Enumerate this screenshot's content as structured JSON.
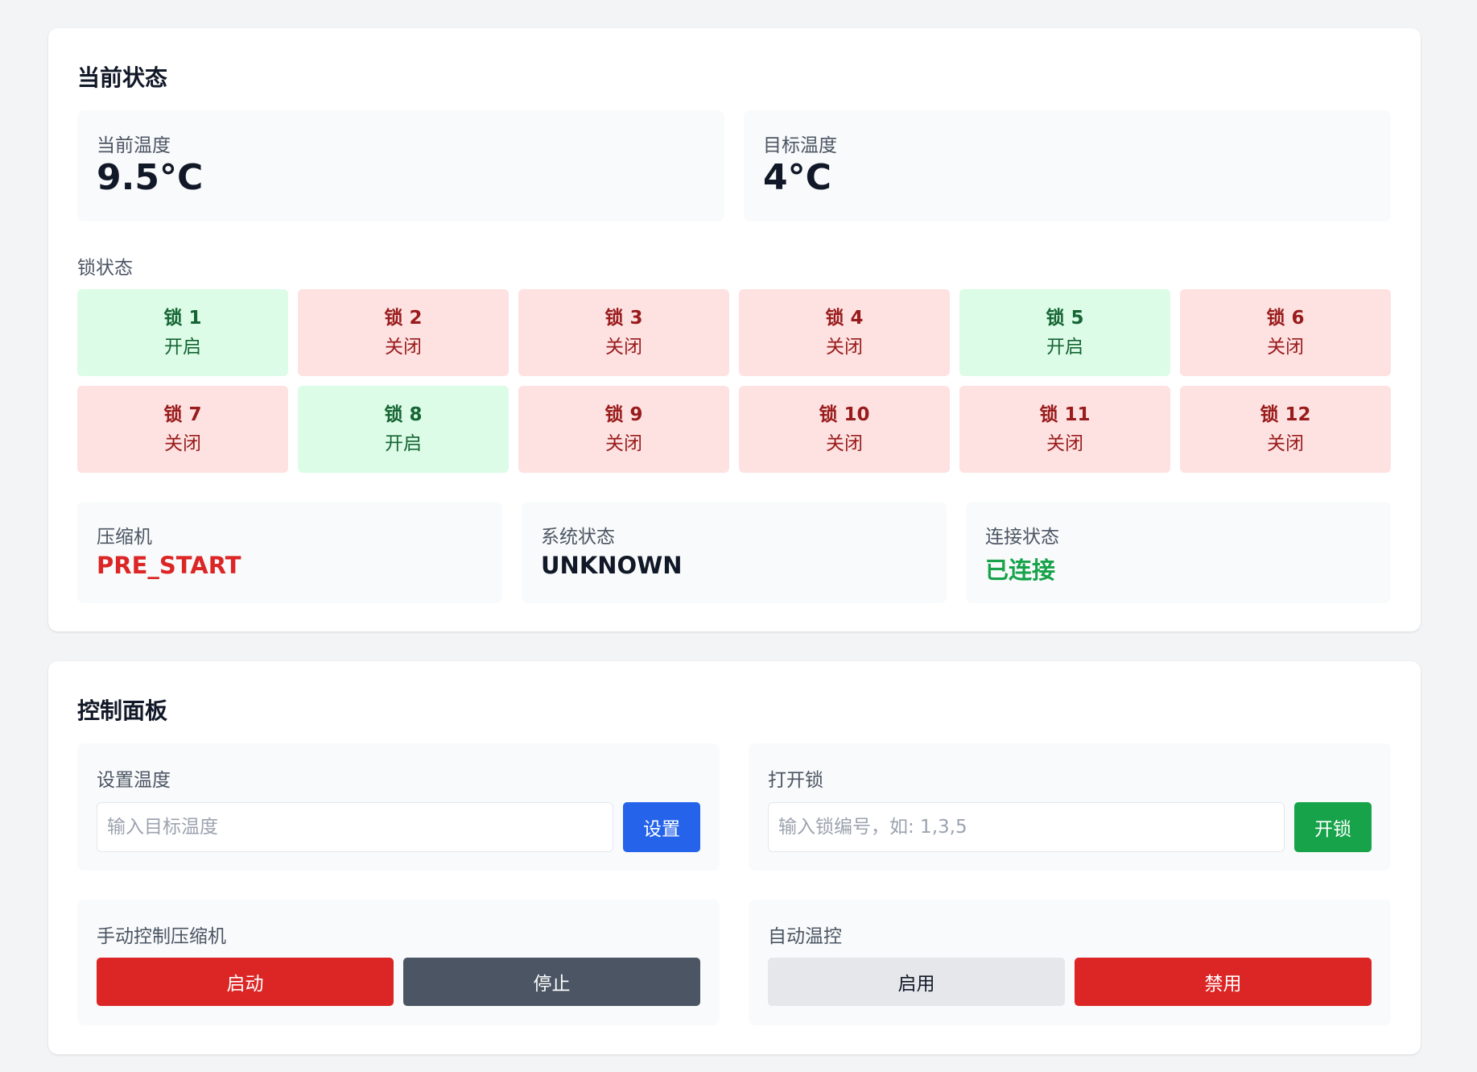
{
  "status": {
    "title": "当前状态",
    "current_temp": {
      "label": "当前温度",
      "value": "9.5°C"
    },
    "target_temp": {
      "label": "目标温度",
      "value": "4°C"
    },
    "locks_label": "锁状态",
    "locks": [
      {
        "name": "锁 1",
        "state": "开启",
        "open": true
      },
      {
        "name": "锁 2",
        "state": "关闭",
        "open": false
      },
      {
        "name": "锁 3",
        "state": "关闭",
        "open": false
      },
      {
        "name": "锁 4",
        "state": "关闭",
        "open": false
      },
      {
        "name": "锁 5",
        "state": "开启",
        "open": true
      },
      {
        "name": "锁 6",
        "state": "关闭",
        "open": false
      },
      {
        "name": "锁 7",
        "state": "关闭",
        "open": false
      },
      {
        "name": "锁 8",
        "state": "开启",
        "open": true
      },
      {
        "name": "锁 9",
        "state": "关闭",
        "open": false
      },
      {
        "name": "锁 10",
        "state": "关闭",
        "open": false
      },
      {
        "name": "锁 11",
        "state": "关闭",
        "open": false
      },
      {
        "name": "锁 12",
        "state": "关闭",
        "open": false
      }
    ],
    "compressor": {
      "label": "压缩机",
      "value": "PRE_START",
      "color": "#dc2626"
    },
    "system": {
      "label": "系统状态",
      "value": "UNKNOWN",
      "color": "#111827"
    },
    "connection": {
      "label": "连接状态",
      "value": "已连接",
      "color": "#16a34a"
    }
  },
  "control": {
    "title": "控制面板",
    "set_temp": {
      "label": "设置温度",
      "placeholder": "输入目标温度",
      "value": "",
      "button": "设置",
      "button_color": "#2563eb"
    },
    "open_lock": {
      "label": "打开锁",
      "placeholder": "输入锁编号，如: 1,3,5",
      "value": "",
      "button": "开锁",
      "button_color": "#16a34a"
    },
    "manual_compressor": {
      "label": "手动控制压缩机",
      "start": "启动",
      "stop": "停止",
      "start_color": "#dc2626",
      "stop_color": "#4b5563"
    },
    "auto_temp": {
      "label": "自动温控",
      "enable": "启用",
      "disable": "禁用",
      "enable_color": "#e5e7eb",
      "disable_color": "#dc2626"
    }
  }
}
